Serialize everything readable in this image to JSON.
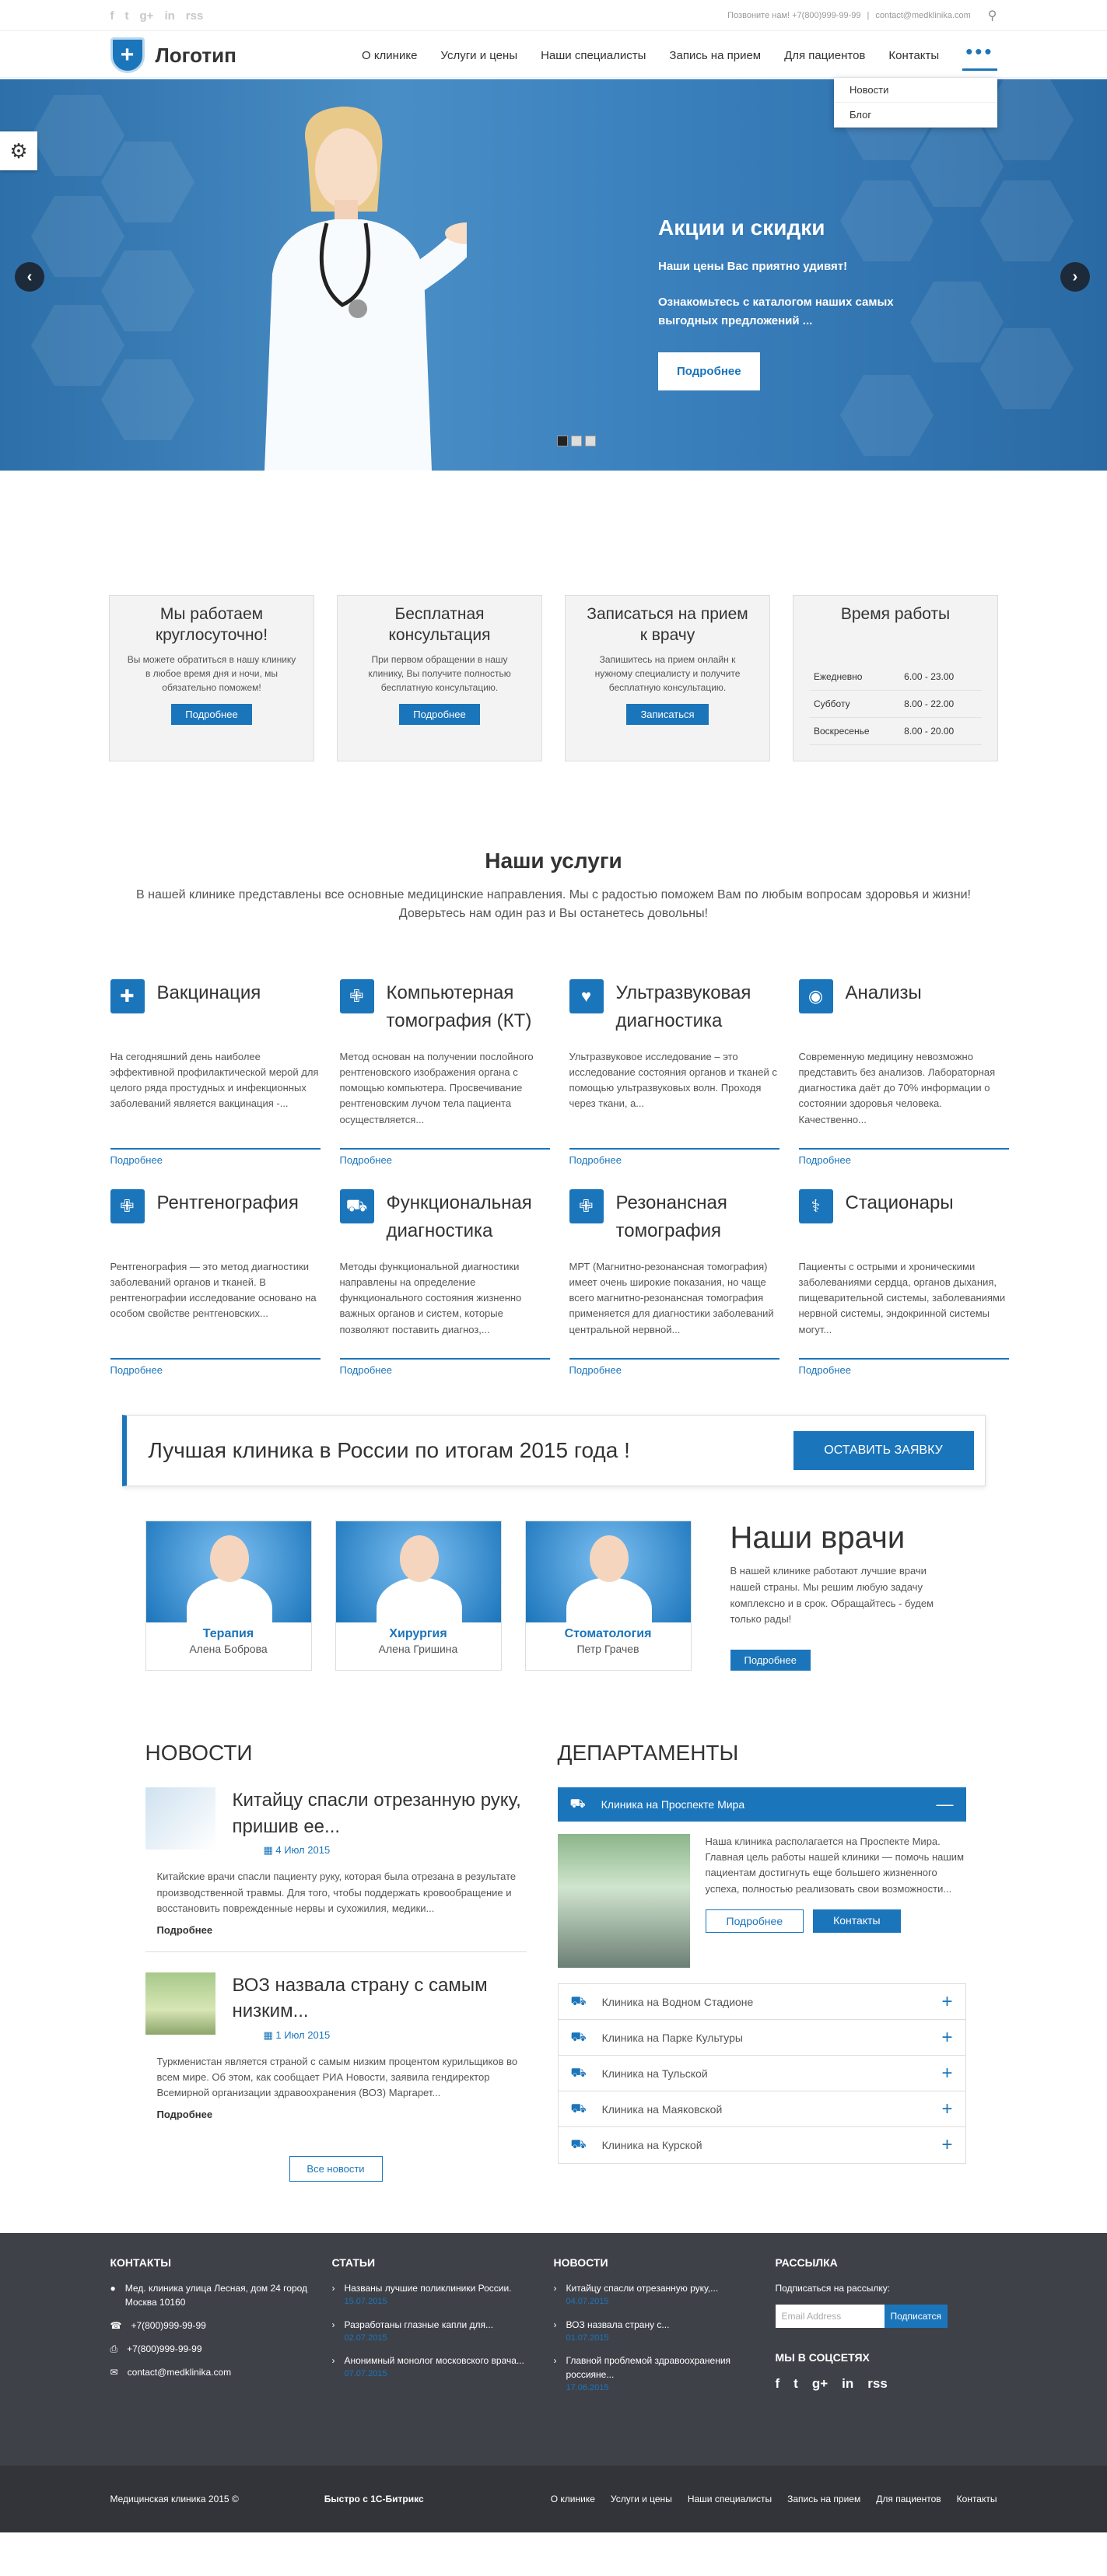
{
  "topbar": {
    "social": [
      "f",
      "t",
      "g+",
      "in",
      "rss"
    ],
    "phone": "Позвоните нам! +7(800)999-99-99",
    "sep": "|",
    "email": "contact@medklinika.com"
  },
  "header": {
    "logo_text": "Логотип",
    "nav": [
      "О клинике",
      "Услуги и цены",
      "Наши специалисты",
      "Запись на прием",
      "Для пациентов",
      "Контакты"
    ],
    "more": "•••",
    "dropdown": [
      "Новости",
      "Блог"
    ]
  },
  "hero": {
    "title": "Акции и скидки",
    "line1": "Наши цены Вас приятно удивят!",
    "line2": "Ознакомьтесь с каталогом наших самых выгодных предложений ...",
    "button": "Подробнее"
  },
  "features": [
    {
      "title": "Мы работаем круглосуточно!",
      "text": "Вы можете обратиться в нашу клинику в любое время дня и ночи, мы обязательно поможем!",
      "button": "Подробнее"
    },
    {
      "title": "Бесплатная консультация",
      "text": "При первом обращении в нашу клинику, Вы получите полностью бесплатную консультацию.",
      "button": "Подробнее"
    },
    {
      "title": "Записаться на прием к врачу",
      "text": "Запишитесь на прием онлайн к нужному специалисту и получите бесплатную консультацию.",
      "button": "Записаться"
    }
  ],
  "hours": {
    "title": "Время работы",
    "rows": [
      [
        "Ежедневно",
        "6.00 - 23.00"
      ],
      [
        "Субботу",
        "8.00 - 22.00"
      ],
      [
        "Воскресенье",
        "8.00 - 20.00"
      ]
    ]
  },
  "services": {
    "title": "Наши услуги",
    "subtitle": "В нашей клинике представлены все основные медицинские направления. Мы с радостью поможем Вам по любым вопросам здоровья и жизни! Доверьтесь нам один раз и Вы останетесь довольны!",
    "more": "Подробнее",
    "items": [
      {
        "title": "Вакцинация",
        "icon": "vaccine-icon",
        "glyph": "✚",
        "text": "На сегодняшний день наиболее эффективной профилактической мерой для целого ряда простудных и инфекционных заболеваний является вакцинация -..."
      },
      {
        "title": "Компьютерная томография (КТ)",
        "icon": "medkit-icon",
        "glyph": "✙",
        "text": "Метод основан на получении послойного рентгеновского изображения органа с помощью компьютера. Просвечивание рентгеновским лучом тела пациента осуществляется..."
      },
      {
        "title": "Ультразвуковая диагностика",
        "icon": "heart-icon",
        "glyph": "♥",
        "text": "Ультразвуковое исследование – это исследование состояния органов и тканей с помощью ультразвуковых волн. Проходя через ткани, а..."
      },
      {
        "title": "Анализы",
        "icon": "eye-icon",
        "glyph": "◉",
        "text": "Современную медицину невозможно представить без анализов. Лабораторная диагностика даёт до 70% информации о состоянии здоровья человека. Качественно..."
      },
      {
        "title": "Рентгенография",
        "icon": "medkit-icon",
        "glyph": "✙",
        "text": "Рентгенография — это метод диагностики заболеваний органов и тканей. В рентгенографии исследование основано на особом свойстве рентгеновских..."
      },
      {
        "title": "Функциональная диагностика",
        "icon": "ambulance-icon",
        "glyph": "⛟",
        "text": "Методы функциональной диагностики направлены на определение функционального состояния жизненно важных органов и систем, которые позволяют поставить диагноз,..."
      },
      {
        "title": "Резонансная томография",
        "icon": "medkit-icon",
        "glyph": "✙",
        "text": "МРТ (Магнитно-резонансная томография) имеет очень широкие показания, но чаще всего магнитно-резонансная томография применяется для диагностики заболеваний центральной нервной..."
      },
      {
        "title": "Стационары",
        "icon": "stethoscope-icon",
        "glyph": "⚕",
        "text": "Пациенты с острыми и хроническими заболеваниями сердца, органов дыхания, пищеварительной системы, заболеваниями нервной системы, эндокринной системы могут..."
      }
    ]
  },
  "banner": {
    "title": "Лучшая клиника в России по итогам 2015 года !",
    "button": "ОСТАВИТЬ ЗАЯВКУ"
  },
  "doctors": {
    "title": "Наши врачи",
    "text": "В нашей клинике работают лучшие врачи нашей страны. Мы решим любую задачу комплексно и в срок. Обращайтесь - будем только рады!",
    "button": "Подробнее",
    "items": [
      {
        "dept": "Терапия",
        "name": "Алена Боброва"
      },
      {
        "dept": "Хирургия",
        "name": "Алена Гришина"
      },
      {
        "dept": "Стоматология",
        "name": "Петр Грачев"
      }
    ]
  },
  "news": {
    "title": "НОВОСТИ",
    "all": "Все новости",
    "more": "Подробнее",
    "items": [
      {
        "title": "Китайцу спасли отрезанную руку, пришив ее...",
        "date": "4 Июл 2015",
        "text": "Китайские врачи спасли пациенту руку, которая была отрезана в результате производственной травмы. Для того, чтобы поддержать кровообращение и восстановить поврежденные нервы и сухожилия, медики..."
      },
      {
        "title": "ВОЗ назвала страну с самым низким...",
        "date": "1 Июл 2015",
        "text": "Туркменистан является страной с самым низким процентом курильщиков во всем мире. Об этом, как сообщает РИА Новости, заявила гендиректор Всемирной организации здравоохранения (ВОЗ) Маргарет..."
      }
    ]
  },
  "departments": {
    "title": "ДЕПАРТАМЕНТЫ",
    "open": {
      "name": "Клиника на Проспекте Мира",
      "text": "Наша клиника располагается на Проспекте Мира. Главная цель работы нашей клиники — помочь нашим пациентам достигнуть еще большего жизненного успеха, полностью реализовать свои возможности...",
      "btn1": "Подробнее",
      "btn2": "Контакты"
    },
    "items": [
      "Клиника на Водном Стадионе",
      "Клиника на Парке Культуры",
      "Клиника на Тульской",
      "Клиника на Маяковской",
      "Клиника на Курской"
    ]
  },
  "footer": {
    "contacts": {
      "title": "КОНТАКТЫ",
      "address": "Мед. клиника улица Лесная, дом 24 город Москва 10160",
      "phone1": "+7(800)999-99-99",
      "phone2": "+7(800)999-99-99",
      "email": "contact@medklinika.com"
    },
    "articles": {
      "title": "СТАТЬИ",
      "items": [
        {
          "text": "Названы лучшие поликлиники России.",
          "date": "15.07.2015"
        },
        {
          "text": "Разработаны глазные капли для...",
          "date": "02.07.2015"
        },
        {
          "text": "Анонимный монолог московского врача...",
          "date": "07.07.2015"
        }
      ]
    },
    "news": {
      "title": "НОВОСТИ",
      "items": [
        {
          "text": "Китайцу спасли отрезанную руку,...",
          "date": "04.07.2015"
        },
        {
          "text": "ВОЗ назвала страну с...",
          "date": "01.07.2015"
        },
        {
          "text": "Главной проблемой здравоохранения россияне...",
          "date": "17.06.2015"
        }
      ]
    },
    "subscribe": {
      "title": "РАССЫЛКА",
      "label": "Подписаться на рассылку:",
      "placeholder": "Email Address",
      "button": "Подписатся",
      "social_title": "МЫ В СОЦСЕТЯХ",
      "social": [
        "f",
        "t",
        "g+",
        "in",
        "rss"
      ]
    },
    "copyright": "Медицинская клиника 2015 ©",
    "bitrix": "Быстро с 1С-Битрикс",
    "nav": [
      "О клинике",
      "Услуги и цены",
      "Наши специалисты",
      "Запись на прием",
      "Для пациентов",
      "Контакты"
    ]
  }
}
